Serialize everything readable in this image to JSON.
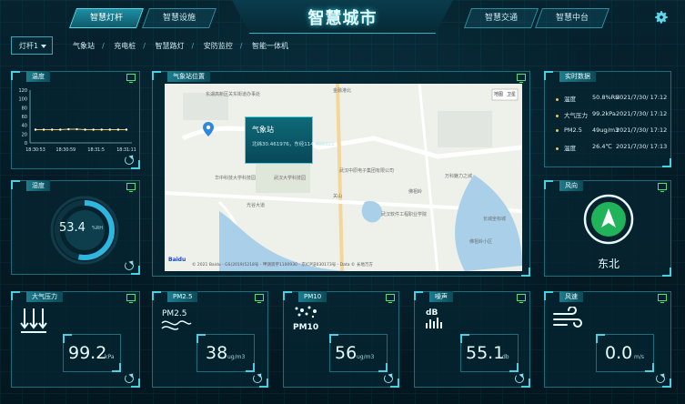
{
  "header": {
    "title": "智慧城市",
    "tabs_left": [
      "智慧灯杆",
      "智慧设施"
    ],
    "tabs_right": [
      "智慧交通",
      "智慧中台"
    ],
    "active_tab": "智慧灯杆",
    "settings_icon": "gear-icon"
  },
  "subnav": {
    "dropdown_value": "灯杆1",
    "items": [
      "气象站",
      "充电桩",
      "智慧路灯",
      "安防监控",
      "智能一体机"
    ]
  },
  "panels": {
    "humidity_chart": {
      "title": "温度"
    },
    "humidity_gauge": {
      "title": "湿度",
      "value": "53.4",
      "unit": "%RH"
    },
    "map": {
      "title": "气象站位置"
    },
    "realtime": {
      "title": "实时数据"
    },
    "wind_direction": {
      "title": "风向",
      "value": "东北"
    },
    "pressure": {
      "title": "大气压力",
      "value": "99.2",
      "unit": "kPa"
    },
    "pm25": {
      "title": "PM2.5",
      "value": "38",
      "unit": "ug/m3"
    },
    "pm10": {
      "title": "PM10",
      "value": "56",
      "unit": "ug/m3"
    },
    "noise": {
      "title": "噪声",
      "value": "55.1",
      "unit": "db"
    },
    "wind_speed": {
      "title": "风速",
      "value": "0.0",
      "unit": "m/s"
    }
  },
  "realtime_rows": [
    {
      "label": "温度",
      "value": "50.8%RH",
      "time": "2021/7/30/ 17:12"
    },
    {
      "label": "大气压力",
      "value": "99.2kPa",
      "time": "2021/7/30/ 17:12"
    },
    {
      "label": "PM2.5",
      "value": "49ug/m3",
      "time": "2021/7/30/ 17:12"
    },
    {
      "label": "温度",
      "value": "26.4℃",
      "time": "2021/7/30/ 17:13"
    }
  ],
  "map": {
    "popup_name": "气象站",
    "popup_coords": "北纬30.461976，东经114.406322",
    "copyright": "© 2021 Baidu - GS(2019)5218号 - 甲测资字1100930 - 京ICP证030173号 - Data © 长地万方",
    "labels": [
      "东湖高新区关东街道办事处",
      "金融港北",
      "武汉大学科技园",
      "武汉中原电子集团有限公司",
      "佛祖岭",
      "关山",
      "华中科技大学科技园",
      "光谷大道",
      "武汉软件工程职业学院",
      "万科魅力之城",
      "长城坐标城",
      "佛祖岭小区"
    ],
    "btn_map": "地图",
    "btn_sat": "卫星"
  },
  "chart_data": {
    "type": "line",
    "x": [
      "18:30:53",
      "18:30:59",
      "18:31:5",
      "18:31:11"
    ],
    "series": [
      {
        "values": [
          30,
          30,
          30,
          30,
          31,
          31,
          30,
          30,
          30,
          30,
          30,
          30
        ]
      }
    ],
    "ylim": [
      0,
      120
    ],
    "yticks": [
      0,
      20,
      40,
      60,
      80,
      100,
      120
    ]
  }
}
